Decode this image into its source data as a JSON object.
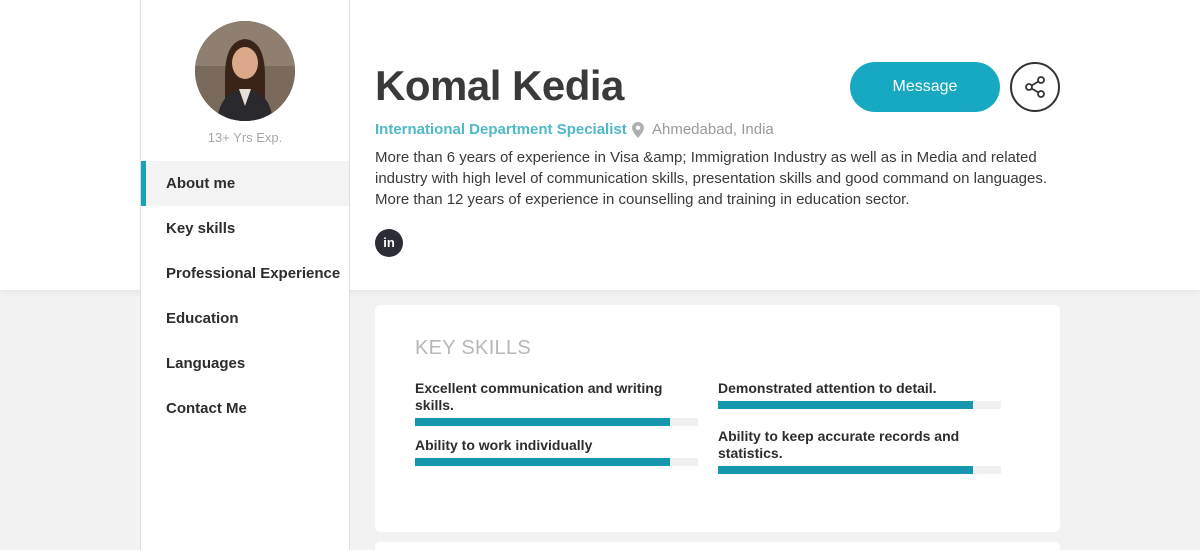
{
  "profile": {
    "name": "Komal Kedia",
    "title": "International Department Specialist",
    "location": "Ahmedabad, India",
    "experience": "13+ Yrs Exp.",
    "bio": "More than 6 years of experience in Visa &amp; Immigration Industry as well as in Media and related industry with high level of communication skills, presentation skills and good command on languages. More than 12 years of experience in counselling and training in education sector.",
    "linkedin_label": "in"
  },
  "actions": {
    "message_label": "Message"
  },
  "sidebar": {
    "items": [
      {
        "label": "About me",
        "active": true
      },
      {
        "label": "Key skills",
        "active": false
      },
      {
        "label": "Professional Experience",
        "active": false
      },
      {
        "label": "Education",
        "active": false
      },
      {
        "label": "Languages",
        "active": false
      },
      {
        "label": "Contact Me",
        "active": false
      }
    ]
  },
  "skills_card": {
    "title": "KEY SKILLS",
    "skills": [
      {
        "label": "Excellent communication and writing skills.",
        "level": 0.9
      },
      {
        "label": "Demonstrated attention to detail.",
        "level": 0.9
      },
      {
        "label": "Ability to work individually",
        "level": 0.9
      },
      {
        "label": "Ability to keep accurate records and statistics.",
        "level": 0.9
      }
    ]
  },
  "colors": {
    "accent": "#17a9c2",
    "bar": "#1797ad",
    "title_text": "#4fb9c6"
  }
}
